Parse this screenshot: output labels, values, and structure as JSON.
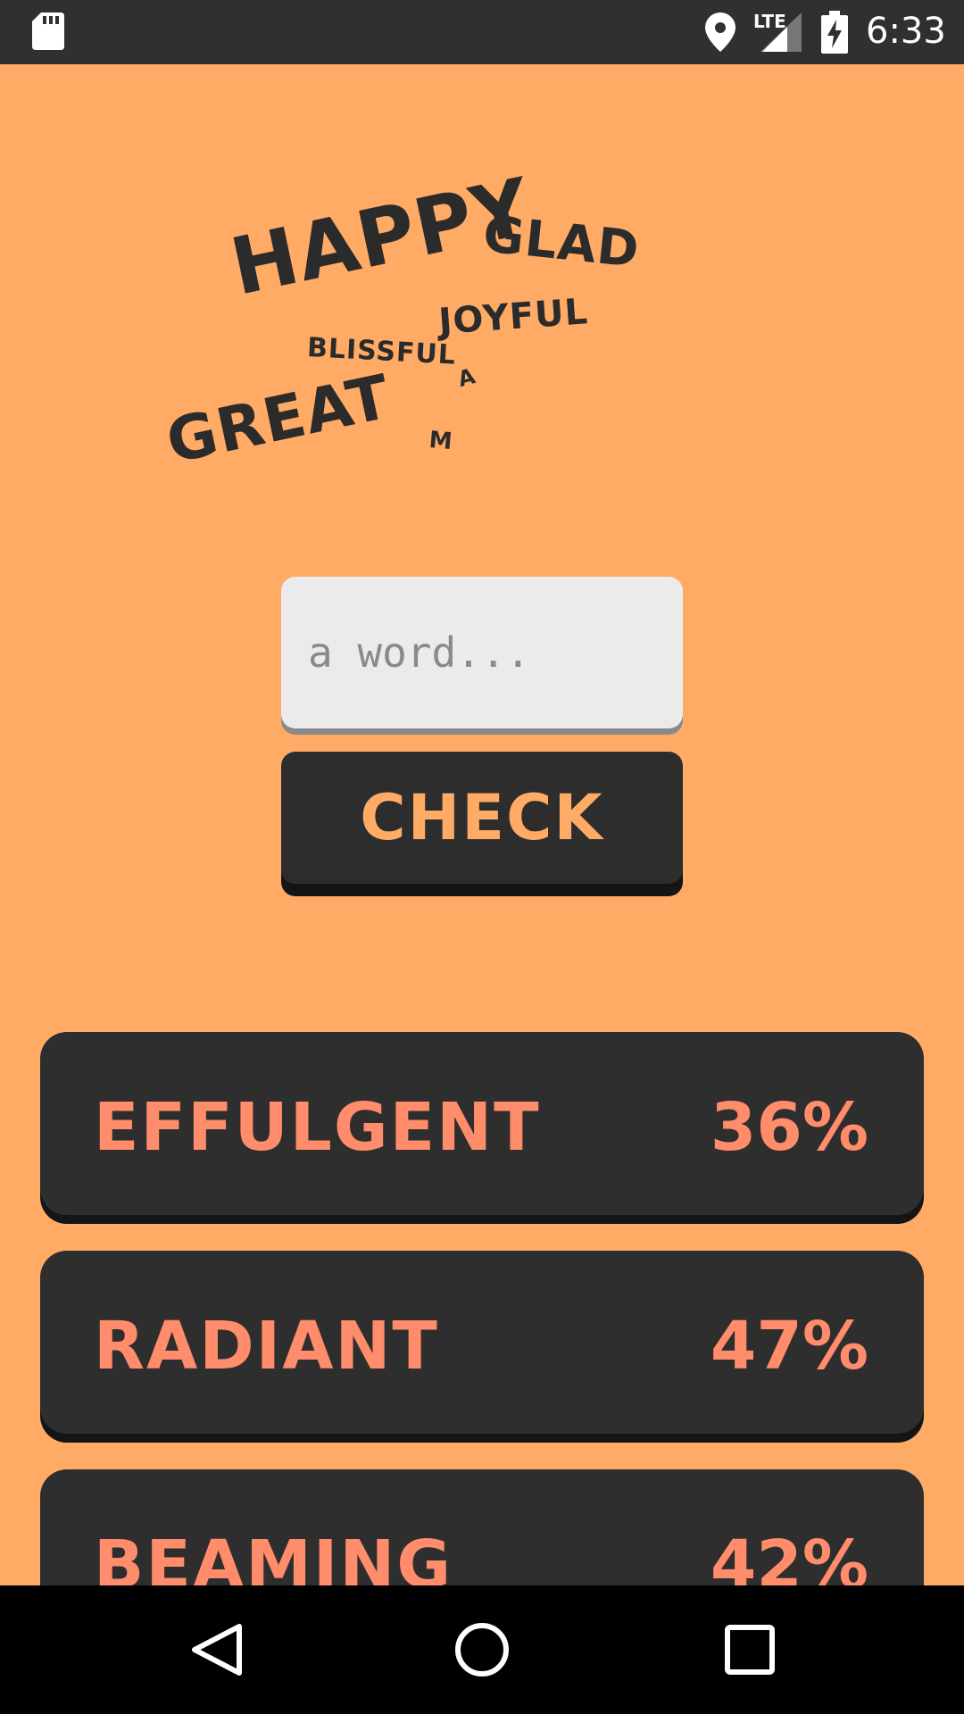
{
  "status_bar": {
    "time": "6:33",
    "network_label": "LTE",
    "icons": [
      "sd-card-icon",
      "location-icon",
      "signal-icon",
      "battery-charging-icon"
    ]
  },
  "word_cloud": {
    "words": [
      "HAPPY",
      "GLAD",
      "JOYFUL",
      "BLISSFUL",
      "GREAT",
      "A",
      "M"
    ]
  },
  "input": {
    "placeholder": "a word...",
    "value": ""
  },
  "check_button": {
    "label": "CHECK"
  },
  "results": [
    {
      "word": "EFFULGENT",
      "percent": "36%"
    },
    {
      "word": "RADIANT",
      "percent": "47%"
    },
    {
      "word": "BEAMING",
      "percent": "42%"
    }
  ],
  "nav_bar": {
    "icons": [
      "back-icon",
      "home-icon",
      "recent-apps-icon"
    ]
  },
  "colors": {
    "background": "#ffab66",
    "card": "#2e2e2e",
    "result_text": "#ff8c6b",
    "button_text": "#ffab66"
  }
}
